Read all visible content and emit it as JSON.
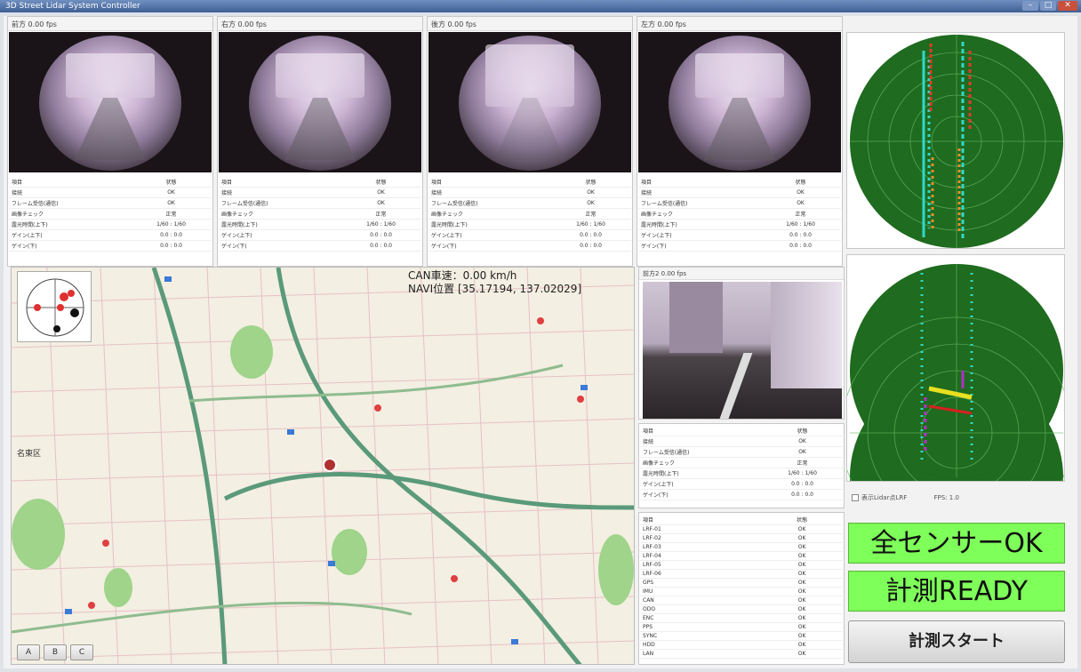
{
  "window": {
    "title": "3D Street Lidar System Controller"
  },
  "cameras": [
    {
      "label": "前方 0.00 fps",
      "rows": [
        [
          "項目",
          "状態"
        ],
        [
          "接続",
          "OK"
        ],
        [
          "フレーム受信(通信)",
          "OK"
        ],
        [
          "画像チェック",
          "正常"
        ],
        [
          "露光時間(上下)",
          "1/60 : 1/60"
        ],
        [
          "ゲイン(上下)",
          "0.0 : 0.0"
        ],
        [
          "ゲイン(下)",
          "0.0 : 0.0"
        ]
      ]
    },
    {
      "label": "右方 0.00 fps",
      "rows": [
        [
          "項目",
          "状態"
        ],
        [
          "接続",
          "OK"
        ],
        [
          "フレーム受信(通信)",
          "OK"
        ],
        [
          "画像チェック",
          "正常"
        ],
        [
          "露光時間(上下)",
          "1/60 : 1/60"
        ],
        [
          "ゲイン(上下)",
          "0.0 : 0.0"
        ],
        [
          "ゲイン(下)",
          "0.0 : 0.0"
        ]
      ]
    },
    {
      "label": "後方 0.00 fps",
      "rows": [
        [
          "項目",
          "状態"
        ],
        [
          "接続",
          "OK"
        ],
        [
          "フレーム受信(通信)",
          "OK"
        ],
        [
          "画像チェック",
          "正常"
        ],
        [
          "露光時間(上下)",
          "1/60 : 1/60"
        ],
        [
          "ゲイン(上下)",
          "0.0 : 0.0"
        ],
        [
          "ゲイン(下)",
          "0.0 : 0.0"
        ]
      ]
    },
    {
      "label": "左方 0.00 fps",
      "rows": [
        [
          "項目",
          "状態"
        ],
        [
          "接続",
          "OK"
        ],
        [
          "フレーム受信(通信)",
          "OK"
        ],
        [
          "画像チェック",
          "正常"
        ],
        [
          "露光時間(上下)",
          "1/60 : 1/60"
        ],
        [
          "ゲイン(上下)",
          "0.0 : 0.0"
        ],
        [
          "ゲイン(下)",
          "0.0 : 0.0"
        ]
      ]
    }
  ],
  "map": {
    "can_speed": "CAN車速：0.00 km/h",
    "navi_pos": "NAVI位置 [35.17194, 137.02029]",
    "buttons": [
      "A",
      "B",
      "C"
    ],
    "area_label": "名東区"
  },
  "rear_camera": {
    "label": "前方2 0.00 fps",
    "rows": [
      [
        "項目",
        "状態"
      ],
      [
        "接続",
        "OK"
      ],
      [
        "フレーム受信(通信)",
        "OK"
      ],
      [
        "画像チェック",
        "正常"
      ],
      [
        "露光時間(上下)",
        "1/60 : 1/60"
      ],
      [
        "ゲイン(上下)",
        "0.0 : 0.0"
      ],
      [
        "ゲイン(下)",
        "0.0 : 0.0"
      ]
    ]
  },
  "status_list": {
    "rows": [
      [
        "項目",
        "状態"
      ],
      [
        "LRF-01",
        "OK"
      ],
      [
        "LRF-02",
        "OK"
      ],
      [
        "LRF-03",
        "OK"
      ],
      [
        "LRF-04",
        "OK"
      ],
      [
        "LRF-05",
        "OK"
      ],
      [
        "LRF-06",
        "OK"
      ],
      [
        "GPS",
        "OK"
      ],
      [
        "IMU",
        "OK"
      ],
      [
        "CAN",
        "OK"
      ],
      [
        "ODO",
        "OK"
      ],
      [
        "ENC",
        "OK"
      ],
      [
        "PPS",
        "OK"
      ],
      [
        "SYNC",
        "OK"
      ],
      [
        "HDD",
        "OK"
      ],
      [
        "LAN",
        "OK"
      ]
    ]
  },
  "gps": {
    "checkbox_label": "表示Lidar点LRF",
    "info": "FPS: 1.0"
  },
  "status": {
    "sensors": "全センサーOK",
    "ready": "計測READY"
  },
  "start_button": "計測スタート"
}
